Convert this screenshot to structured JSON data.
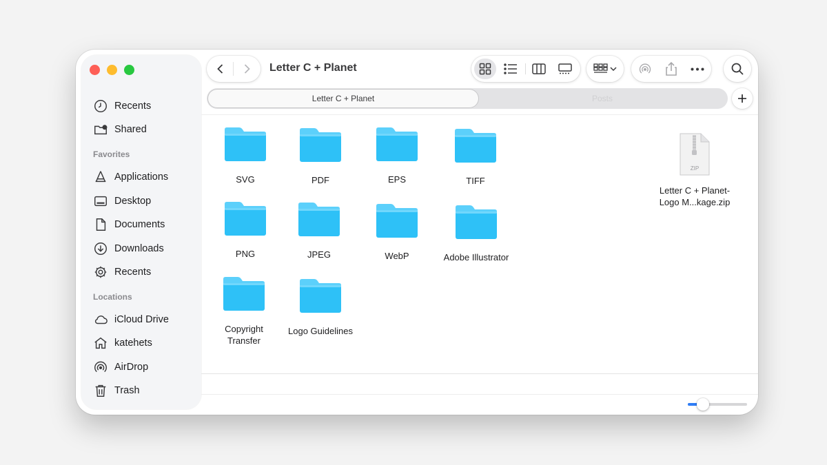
{
  "window": {
    "title": "Letter C + Planet"
  },
  "sidebar": {
    "top_items": [
      {
        "label": "Recents",
        "icon": "clock-icon"
      },
      {
        "label": "Shared",
        "icon": "shared-folder-icon"
      }
    ],
    "favorites_heading": "Favorites",
    "favorites": [
      {
        "label": "Applications",
        "icon": "applications-icon"
      },
      {
        "label": "Desktop",
        "icon": "desktop-icon"
      },
      {
        "label": "Documents",
        "icon": "document-icon"
      },
      {
        "label": "Downloads",
        "icon": "download-icon"
      },
      {
        "label": "Recents",
        "icon": "gear-icon"
      }
    ],
    "locations_heading": "Locations",
    "locations": [
      {
        "label": "iCloud Drive",
        "icon": "cloud-icon"
      },
      {
        "label": "katehets",
        "icon": "home-icon"
      },
      {
        "label": "AirDrop",
        "icon": "airdrop-icon"
      },
      {
        "label": "Trash",
        "icon": "trash-icon"
      }
    ]
  },
  "tabs": [
    {
      "label": "Letter C + Planet",
      "active": true
    },
    {
      "label": "Posts",
      "active": false
    }
  ],
  "items": [
    {
      "name": "SVG",
      "type": "folder"
    },
    {
      "name": "PDF",
      "type": "folder"
    },
    {
      "name": "EPS",
      "type": "folder"
    },
    {
      "name": "TIFF",
      "type": "folder"
    },
    {
      "name": "PNG",
      "type": "folder"
    },
    {
      "name": "JPEG",
      "type": "folder"
    },
    {
      "name": "WebP",
      "type": "folder"
    },
    {
      "name": "Adobe Illustrator",
      "type": "folder"
    },
    {
      "name_line1": "Copyright",
      "name_line2": "Transfer",
      "type": "folder"
    },
    {
      "name": "Logo Guidelines",
      "type": "folder"
    }
  ],
  "zip_file": {
    "name_line1": "Letter C + Planet-",
    "name_line2": "Logo M...kage.zip",
    "badge": "ZIP"
  },
  "icon_size_slider": {
    "value_fraction": 0.25
  },
  "colors": {
    "folder_body": "#2ec1f7",
    "folder_tab": "#5cd0fb",
    "accent": "#2f7df6",
    "close": "#fe5f57",
    "minimize": "#febc2e",
    "zoom": "#28c840"
  }
}
